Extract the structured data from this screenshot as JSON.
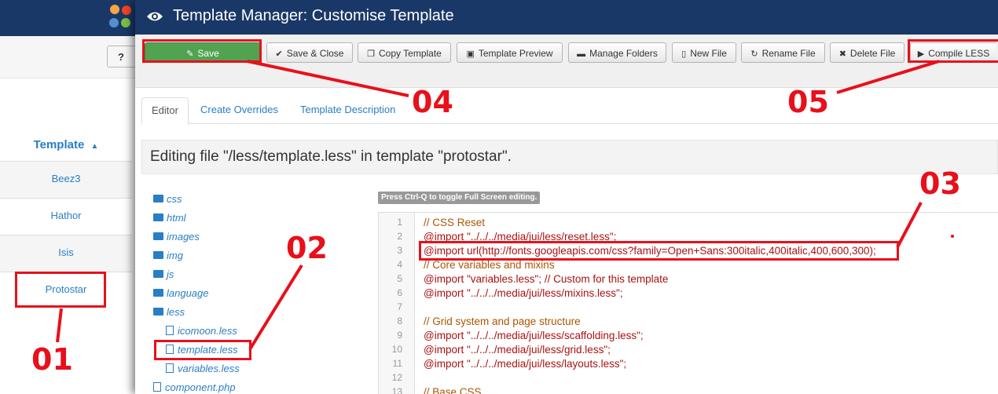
{
  "background": {
    "help_button_label": "?",
    "template_column_header": "Template",
    "templates": [
      "Beez3",
      "Hathor",
      "Isis",
      "Protostar"
    ]
  },
  "modal": {
    "title": "Template Manager: Customise Template",
    "toolbar": {
      "save": "Save",
      "save_close": "Save & Close",
      "copy_template": "Copy Template",
      "template_preview": "Template Preview",
      "manage_folders": "Manage Folders",
      "new_file": "New File",
      "rename_file": "Rename File",
      "delete_file": "Delete File",
      "compile_less": "Compile LESS"
    },
    "tabs": [
      "Editor",
      "Create Overrides",
      "Template Description"
    ],
    "active_tab": "Editor",
    "editing_heading": "Editing file \"/less/template.less\" in template \"protostar\".",
    "file_tree": {
      "folders": [
        "css",
        "html",
        "images",
        "img",
        "js",
        "language",
        "less"
      ],
      "less_files": [
        "icomoon.less",
        "template.less",
        "variables.less"
      ],
      "root_files": [
        "component.php"
      ]
    },
    "editor_hint": "Press Ctrl-Q to toggle Full Screen editing.",
    "code_lines": [
      {
        "n": "1",
        "text": "// CSS Reset"
      },
      {
        "n": "2",
        "text": "@import \"../../../media/jui/less/reset.less\";"
      },
      {
        "n": "3",
        "text": "@import url(http://fonts.googleapis.com/css?family=Open+Sans:300italic,400italic,400,600,300);"
      },
      {
        "n": "4",
        "text": "// Core variables and mixins"
      },
      {
        "n": "5",
        "text": "@import \"variables.less\"; // Custom for this template"
      },
      {
        "n": "6",
        "text": "@import \"../../../media/jui/less/mixins.less\";"
      },
      {
        "n": "7",
        "text": ""
      },
      {
        "n": "8",
        "text": "// Grid system and page structure"
      },
      {
        "n": "9",
        "text": "@import \"../../../media/jui/less/scaffolding.less\";"
      },
      {
        "n": "10",
        "text": "@import \"../../../media/jui/less/grid.less\";"
      },
      {
        "n": "11",
        "text": "@import \"../../../media/jui/less/layouts.less\";"
      },
      {
        "n": "12",
        "text": ""
      },
      {
        "n": "13",
        "text": "// Base CSS"
      }
    ]
  },
  "annotations": [
    "01",
    "02",
    "03",
    "04",
    "05"
  ],
  "colors": {
    "header_blue": "#1a3867",
    "link_blue": "#2a7ec3",
    "save_green": "#51a351",
    "annotation_red": "#e8101b"
  }
}
